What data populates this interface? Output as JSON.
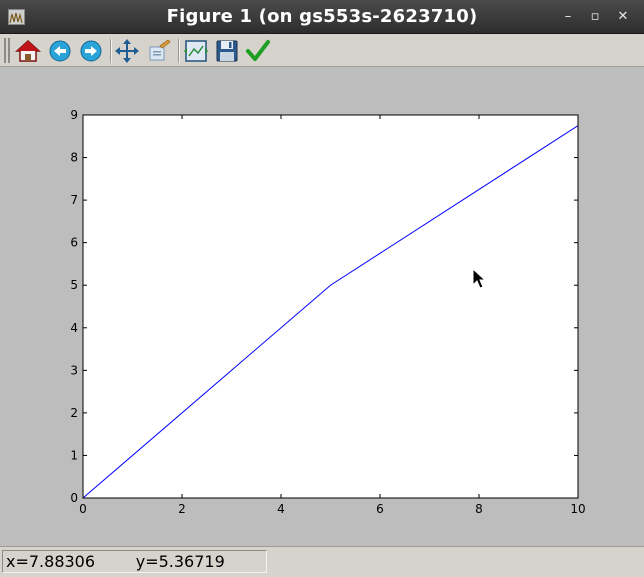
{
  "window": {
    "title": "Figure 1 (on gs553s-2623710)",
    "minimize_glyph": "–",
    "maximize_glyph": "▫",
    "close_glyph": "✕"
  },
  "toolbar": {
    "buttons": [
      {
        "name": "home-icon",
        "label": "Home"
      },
      {
        "name": "back-icon",
        "label": "Back"
      },
      {
        "name": "forward-icon",
        "label": "Forward"
      },
      {
        "name": "pan-icon",
        "label": "Pan"
      },
      {
        "name": "zoom-icon",
        "label": "Zoom"
      },
      {
        "name": "subplots-icon",
        "label": "Subplots"
      },
      {
        "name": "save-icon",
        "label": "Save"
      },
      {
        "name": "edit-parameters-icon",
        "label": "Edit"
      }
    ]
  },
  "status": {
    "text": "x=7.88306        y=5.36719"
  },
  "colors": {
    "line": "#0000ff",
    "figure_bg": "#bdbdbd",
    "axes_bg": "#ffffff"
  },
  "chart_data": {
    "type": "line",
    "title": "",
    "xlabel": "",
    "ylabel": "",
    "xlim": [
      0,
      10
    ],
    "ylim": [
      0,
      9
    ],
    "xticks": [
      0,
      2,
      4,
      6,
      8,
      10
    ],
    "yticks": [
      0,
      1,
      2,
      3,
      4,
      5,
      6,
      7,
      8,
      9
    ],
    "grid": false,
    "series": [
      {
        "x": [
          0,
          5,
          10
        ],
        "y": [
          0,
          5,
          8.75
        ]
      }
    ]
  }
}
